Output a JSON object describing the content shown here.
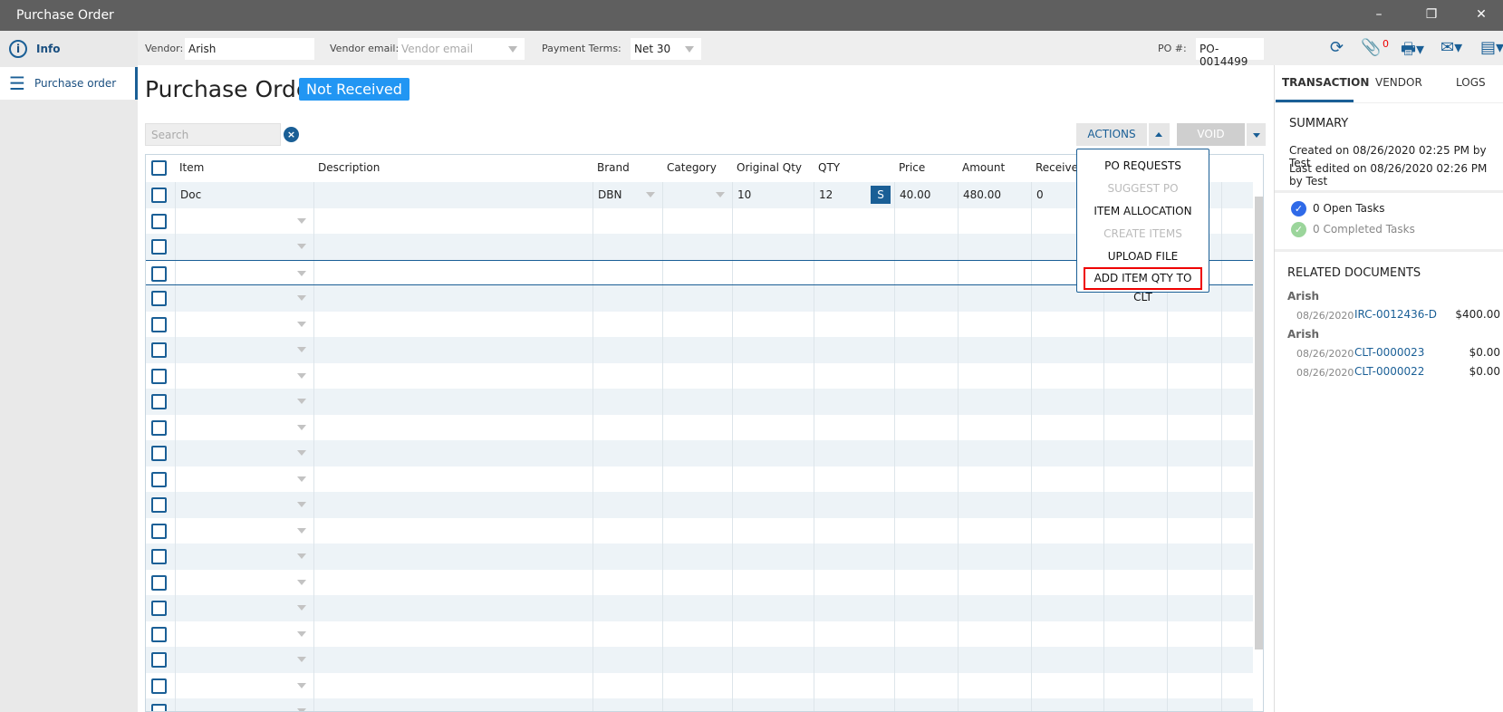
{
  "window": {
    "title": "Purchase Order"
  },
  "sidebar": {
    "items": [
      {
        "label": "Info",
        "icon": "info-icon"
      },
      {
        "label": "Purchase order",
        "icon": "list-icon"
      }
    ]
  },
  "toolbar": {
    "vendor_label": "Vendor:",
    "vendor_value": "Arish",
    "vendor_email_label": "Vendor email:",
    "vendor_email_placeholder": "Vendor email",
    "payment_terms_label": "Payment Terms:",
    "payment_terms_value": "Net 30",
    "po_label": "PO #:",
    "po_value": "PO-0014499",
    "attachment_count": "0"
  },
  "main": {
    "title": "Purchase Order",
    "status": "Not Received",
    "search_placeholder": "Search",
    "actions_label": "ACTIONS",
    "void_label": "VOID",
    "columns": [
      "Item",
      "Description",
      "Brand",
      "Category",
      "Original Qty",
      "QTY",
      "Price",
      "Amount",
      "Received"
    ],
    "rows": [
      {
        "item": "Doc",
        "description": "",
        "brand": "DBN",
        "category": "",
        "original_qty": "10",
        "qty": "12",
        "qty_button": "S",
        "price": "40.00",
        "amount": "480.00",
        "received": "0"
      }
    ]
  },
  "actions_menu": [
    {
      "label": "PO REQUESTS",
      "enabled": true
    },
    {
      "label": "SUGGEST PO",
      "enabled": false
    },
    {
      "label": "ITEM ALLOCATION",
      "enabled": true
    },
    {
      "label": "CREATE ITEMS",
      "enabled": false
    },
    {
      "label": "UPLOAD FILE",
      "enabled": true
    },
    {
      "label": "ADD ITEM QTY TO CLT",
      "enabled": true,
      "highlighted": true
    }
  ],
  "right_panel": {
    "tabs": [
      "TRANSACTION",
      "VENDOR",
      "LOGS"
    ],
    "active_tab": "TRANSACTION",
    "summary_title": "SUMMARY",
    "created": "Created on 08/26/2020 02:25 PM by Test",
    "edited": "Last edited on 08/26/2020 02:26 PM by Test",
    "open_tasks": "0 Open Tasks",
    "completed_tasks": "0 Completed Tasks",
    "related_title": "RELATED DOCUMENTS",
    "groups": [
      {
        "name": "Arish",
        "docs": [
          {
            "date": "08/26/2020",
            "id": "IRC-0012436-D",
            "amount": "$400.00"
          }
        ]
      },
      {
        "name": "Arish",
        "docs": [
          {
            "date": "08/26/2020",
            "id": "CLT-0000023",
            "amount": "$0.00"
          },
          {
            "date": "08/26/2020",
            "id": "CLT-0000022",
            "amount": "$0.00"
          }
        ]
      }
    ]
  },
  "colors": {
    "accent": "#1a5f96",
    "badge": "#2196f3",
    "highlight": "#e00000"
  }
}
